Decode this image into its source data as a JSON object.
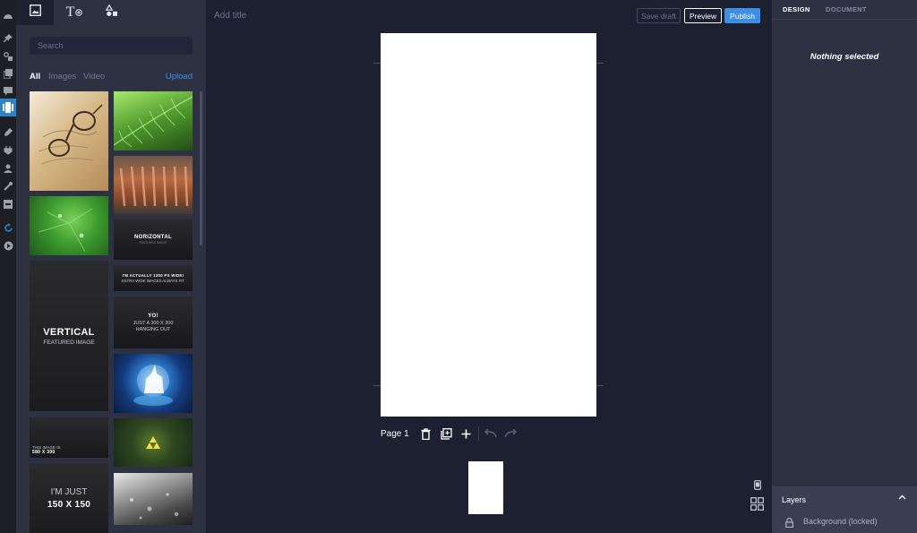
{
  "library": {
    "search_placeholder": "Search",
    "filters": [
      "All",
      "Images",
      "Video"
    ],
    "upload_label": "Upload",
    "tab_text_label": "T",
    "thumbs": {
      "horizontal_title": "NORIZONTAL",
      "horizontal_sub": "FEATURED IMAGE",
      "wide_line1": "I'M ACTUALLY 1200 PX WIDE!",
      "wide_line2": "EXTRA WIDE IMAGES ALWAYS FIT",
      "vertical_title": "VERTICAL",
      "vertical_sub": "FEATURED IMAGE",
      "yo_title": "YO!",
      "yo_line1": "JUST A 300 X 200",
      "yo_line2": "HANGING OUT",
      "small_line1": "THIS IMAGE IS",
      "small_line2": "580 X 300",
      "square_line1": "I'M JUST",
      "square_line2": "150 X 150"
    }
  },
  "editor": {
    "title_placeholder": "Add title",
    "save_draft": "Save draft",
    "preview": "Preview",
    "publish": "Publish",
    "page_label": "Page 1"
  },
  "panel": {
    "tabs": [
      "DESIGN",
      "DOCUMENT"
    ],
    "empty_state": "Nothing selected",
    "layers_title": "Layers",
    "layers": [
      {
        "label": "Background (locked)"
      }
    ]
  },
  "colors": {
    "accent": "#3e8ee6",
    "wp_active": "#2f84c8",
    "canvas_bg": "#1d2030",
    "panel_bg": "#2d3142"
  }
}
